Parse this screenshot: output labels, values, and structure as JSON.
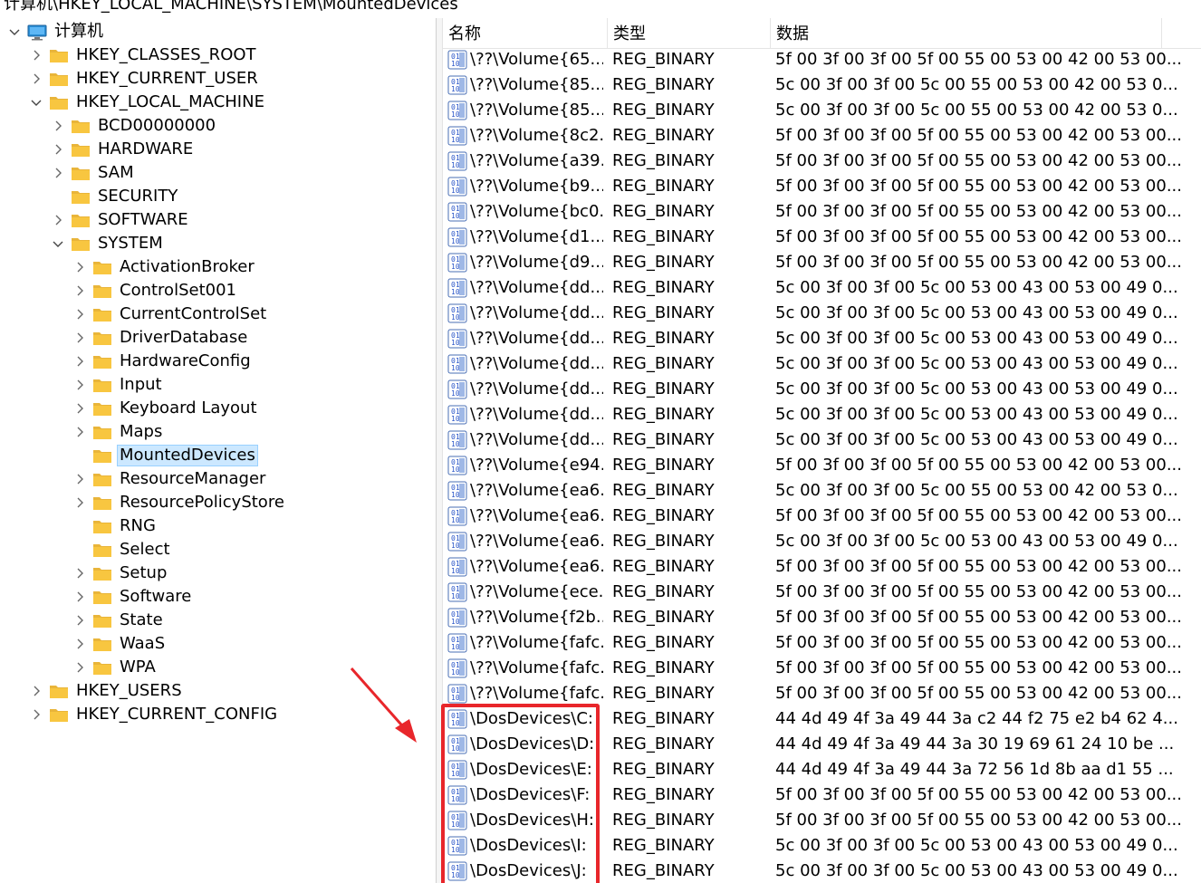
{
  "address_bar": "计算机\\HKEY_LOCAL_MACHINE\\SYSTEM\\MountedDevices",
  "tree": [
    {
      "label": "计算机",
      "level": 0,
      "expander": "expanded",
      "icon": "computer-icon"
    },
    {
      "label": "HKEY_CLASSES_ROOT",
      "level": 1,
      "expander": "collapsed",
      "icon": "folder-icon"
    },
    {
      "label": "HKEY_CURRENT_USER",
      "level": 1,
      "expander": "collapsed",
      "icon": "folder-icon"
    },
    {
      "label": "HKEY_LOCAL_MACHINE",
      "level": 1,
      "expander": "expanded",
      "icon": "folder-icon"
    },
    {
      "label": "BCD00000000",
      "level": 2,
      "expander": "collapsed",
      "icon": "folder-icon"
    },
    {
      "label": "HARDWARE",
      "level": 2,
      "expander": "collapsed",
      "icon": "folder-icon"
    },
    {
      "label": "SAM",
      "level": 2,
      "expander": "collapsed",
      "icon": "folder-icon"
    },
    {
      "label": "SECURITY",
      "level": 2,
      "expander": "none",
      "icon": "folder-icon"
    },
    {
      "label": "SOFTWARE",
      "level": 2,
      "expander": "collapsed",
      "icon": "folder-icon"
    },
    {
      "label": "SYSTEM",
      "level": 2,
      "expander": "expanded",
      "icon": "folder-icon"
    },
    {
      "label": "ActivationBroker",
      "level": 3,
      "expander": "collapsed",
      "icon": "folder-icon"
    },
    {
      "label": "ControlSet001",
      "level": 3,
      "expander": "collapsed",
      "icon": "folder-icon"
    },
    {
      "label": "CurrentControlSet",
      "level": 3,
      "expander": "collapsed",
      "icon": "folder-icon"
    },
    {
      "label": "DriverDatabase",
      "level": 3,
      "expander": "collapsed",
      "icon": "folder-icon"
    },
    {
      "label": "HardwareConfig",
      "level": 3,
      "expander": "collapsed",
      "icon": "folder-icon"
    },
    {
      "label": "Input",
      "level": 3,
      "expander": "collapsed",
      "icon": "folder-icon"
    },
    {
      "label": "Keyboard Layout",
      "level": 3,
      "expander": "collapsed",
      "icon": "folder-icon"
    },
    {
      "label": "Maps",
      "level": 3,
      "expander": "collapsed",
      "icon": "folder-icon"
    },
    {
      "label": "MountedDevices",
      "level": 3,
      "expander": "none",
      "icon": "folder-icon",
      "selected": true
    },
    {
      "label": "ResourceManager",
      "level": 3,
      "expander": "collapsed",
      "icon": "folder-icon"
    },
    {
      "label": "ResourcePolicyStore",
      "level": 3,
      "expander": "collapsed",
      "icon": "folder-icon"
    },
    {
      "label": "RNG",
      "level": 3,
      "expander": "none",
      "icon": "folder-icon"
    },
    {
      "label": "Select",
      "level": 3,
      "expander": "none",
      "icon": "folder-icon"
    },
    {
      "label": "Setup",
      "level": 3,
      "expander": "collapsed",
      "icon": "folder-icon"
    },
    {
      "label": "Software",
      "level": 3,
      "expander": "collapsed",
      "icon": "folder-icon"
    },
    {
      "label": "State",
      "level": 3,
      "expander": "collapsed",
      "icon": "folder-icon"
    },
    {
      "label": "WaaS",
      "level": 3,
      "expander": "collapsed",
      "icon": "folder-icon"
    },
    {
      "label": "WPA",
      "level": 3,
      "expander": "collapsed",
      "icon": "folder-icon"
    },
    {
      "label": "HKEY_USERS",
      "level": 1,
      "expander": "collapsed",
      "icon": "folder-icon"
    },
    {
      "label": "HKEY_CURRENT_CONFIG",
      "level": 1,
      "expander": "collapsed",
      "icon": "folder-icon"
    }
  ],
  "columns": {
    "name": "名称",
    "type": "类型",
    "data": "数据"
  },
  "values": [
    {
      "name": "\\??\\Volume{65...",
      "type": "REG_BINARY",
      "data": "5f 00 3f 00 3f 00 5f 00 55 00 53 00 42 00 53 00..."
    },
    {
      "name": "\\??\\Volume{85...",
      "type": "REG_BINARY",
      "data": "5c 00 3f 00 3f 00 5c 00 55 00 53 00 42 00 53 0..."
    },
    {
      "name": "\\??\\Volume{85...",
      "type": "REG_BINARY",
      "data": "5c 00 3f 00 3f 00 5c 00 55 00 53 00 42 00 53 0..."
    },
    {
      "name": "\\??\\Volume{8c2...",
      "type": "REG_BINARY",
      "data": "5f 00 3f 00 3f 00 5f 00 55 00 53 00 42 00 53 00..."
    },
    {
      "name": "\\??\\Volume{a39...",
      "type": "REG_BINARY",
      "data": "5f 00 3f 00 3f 00 5f 00 55 00 53 00 42 00 53 00..."
    },
    {
      "name": "\\??\\Volume{b9...",
      "type": "REG_BINARY",
      "data": "5f 00 3f 00 3f 00 5f 00 55 00 53 00 42 00 53 00..."
    },
    {
      "name": "\\??\\Volume{bc0...",
      "type": "REG_BINARY",
      "data": "5f 00 3f 00 3f 00 5f 00 55 00 53 00 42 00 53 00..."
    },
    {
      "name": "\\??\\Volume{d1...",
      "type": "REG_BINARY",
      "data": "5f 00 3f 00 3f 00 5f 00 55 00 53 00 42 00 53 00..."
    },
    {
      "name": "\\??\\Volume{d9...",
      "type": "REG_BINARY",
      "data": "5f 00 3f 00 3f 00 5f 00 55 00 53 00 42 00 53 00..."
    },
    {
      "name": "\\??\\Volume{dd...",
      "type": "REG_BINARY",
      "data": "5c 00 3f 00 3f 00 5c 00 53 00 43 00 53 00 49 0..."
    },
    {
      "name": "\\??\\Volume{dd...",
      "type": "REG_BINARY",
      "data": "5c 00 3f 00 3f 00 5c 00 53 00 43 00 53 00 49 0..."
    },
    {
      "name": "\\??\\Volume{dd...",
      "type": "REG_BINARY",
      "data": "5c 00 3f 00 3f 00 5c 00 53 00 43 00 53 00 49 0..."
    },
    {
      "name": "\\??\\Volume{dd...",
      "type": "REG_BINARY",
      "data": "5c 00 3f 00 3f 00 5c 00 53 00 43 00 53 00 49 0..."
    },
    {
      "name": "\\??\\Volume{dd...",
      "type": "REG_BINARY",
      "data": "5c 00 3f 00 3f 00 5c 00 53 00 43 00 53 00 49 0..."
    },
    {
      "name": "\\??\\Volume{dd...",
      "type": "REG_BINARY",
      "data": "5c 00 3f 00 3f 00 5c 00 53 00 43 00 53 00 49 0..."
    },
    {
      "name": "\\??\\Volume{dd...",
      "type": "REG_BINARY",
      "data": "5c 00 3f 00 3f 00 5c 00 53 00 43 00 53 00 49 0..."
    },
    {
      "name": "\\??\\Volume{e94...",
      "type": "REG_BINARY",
      "data": "5f 00 3f 00 3f 00 5f 00 55 00 53 00 42 00 53 00..."
    },
    {
      "name": "\\??\\Volume{ea6...",
      "type": "REG_BINARY",
      "data": "5c 00 3f 00 3f 00 5c 00 55 00 53 00 42 00 53 0..."
    },
    {
      "name": "\\??\\Volume{ea6...",
      "type": "REG_BINARY",
      "data": "5f 00 3f 00 3f 00 5f 00 55 00 53 00 42 00 53 00..."
    },
    {
      "name": "\\??\\Volume{ea6...",
      "type": "REG_BINARY",
      "data": "5c 00 3f 00 3f 00 5c 00 53 00 43 00 53 00 49 0..."
    },
    {
      "name": "\\??\\Volume{ea6...",
      "type": "REG_BINARY",
      "data": "5f 00 3f 00 3f 00 5f 00 55 00 53 00 42 00 53 00..."
    },
    {
      "name": "\\??\\Volume{ece...",
      "type": "REG_BINARY",
      "data": "5f 00 3f 00 3f 00 5f 00 55 00 53 00 42 00 53 00..."
    },
    {
      "name": "\\??\\Volume{f2b...",
      "type": "REG_BINARY",
      "data": "5f 00 3f 00 3f 00 5f 00 55 00 53 00 42 00 53 00..."
    },
    {
      "name": "\\??\\Volume{fafc...",
      "type": "REG_BINARY",
      "data": "5f 00 3f 00 3f 00 5f 00 55 00 53 00 42 00 53 00..."
    },
    {
      "name": "\\??\\Volume{fafc...",
      "type": "REG_BINARY",
      "data": "5f 00 3f 00 3f 00 5f 00 55 00 53 00 42 00 53 00..."
    },
    {
      "name": "\\??\\Volume{fafc...",
      "type": "REG_BINARY",
      "data": "5f 00 3f 00 3f 00 5f 00 55 00 53 00 42 00 53 00..."
    },
    {
      "name": "\\DosDevices\\C:",
      "type": "REG_BINARY",
      "data": "44 4d 49 4f 3a 49 44 3a c2 44 f2 75 e2 b4 62 4..."
    },
    {
      "name": "\\DosDevices\\D:",
      "type": "REG_BINARY",
      "data": "44 4d 49 4f 3a 49 44 3a 30 19 69 61 24 10 be ..."
    },
    {
      "name": "\\DosDevices\\E:",
      "type": "REG_BINARY",
      "data": "44 4d 49 4f 3a 49 44 3a 72 56 1d 8b aa d1 55 ..."
    },
    {
      "name": "\\DosDevices\\F:",
      "type": "REG_BINARY",
      "data": "5f 00 3f 00 3f 00 5f 00 55 00 53 00 42 00 53 00..."
    },
    {
      "name": "\\DosDevices\\H:",
      "type": "REG_BINARY",
      "data": "5f 00 3f 00 3f 00 5f 00 55 00 53 00 42 00 53 00..."
    },
    {
      "name": "\\DosDevices\\I:",
      "type": "REG_BINARY",
      "data": "5c 00 3f 00 3f 00 5c 00 53 00 43 00 53 00 49 0..."
    },
    {
      "name": "\\DosDevices\\J:",
      "type": "REG_BINARY",
      "data": "5c 00 3f 00 3f 00 5c 00 53 00 43 00 53 00 49 0..."
    }
  ],
  "colors": {
    "highlight_box": "#e8262b",
    "arrow": "#e8262b",
    "selection": "#cce8ff",
    "folder": "#f8c640"
  },
  "annotation_icon": "red-arrow-icon"
}
